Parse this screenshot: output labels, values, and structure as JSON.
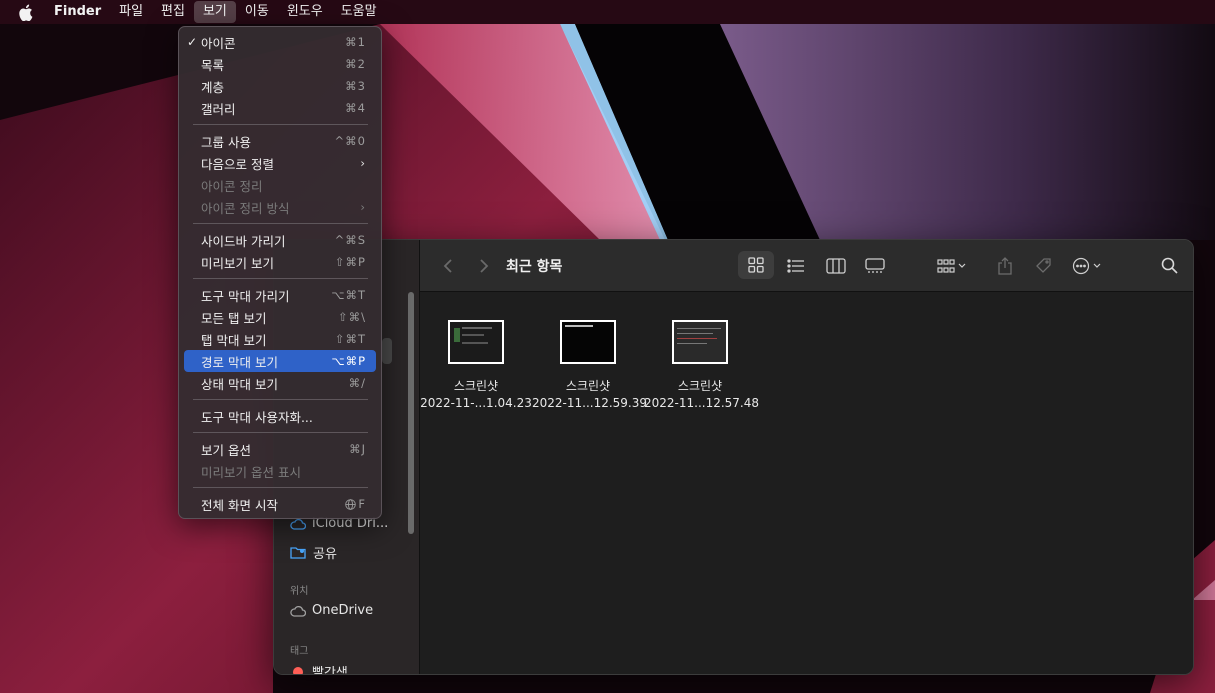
{
  "menubar": {
    "app": "Finder",
    "items": [
      "파일",
      "편집",
      "보기",
      "이동",
      "윈도우",
      "도움말"
    ],
    "active": "보기"
  },
  "view_menu": {
    "items": [
      {
        "label": "아이콘",
        "shortcut": "⌘1",
        "checked": true
      },
      {
        "label": "목록",
        "shortcut": "⌘2"
      },
      {
        "label": "계층",
        "shortcut": "⌘3"
      },
      {
        "label": "갤러리",
        "shortcut": "⌘4"
      },
      {
        "label": "그룹 사용",
        "shortcut": "^⌘0"
      },
      {
        "label": "다음으로 정렬",
        "shortcut": "",
        "submenu": true
      },
      {
        "label": "아이콘 정리",
        "shortcut": "",
        "disabled": true
      },
      {
        "label": "아이콘 정리 방식",
        "shortcut": "",
        "disabled": true,
        "submenu": true
      },
      {
        "label": "사이드바 가리기",
        "shortcut": "^⌘S"
      },
      {
        "label": "미리보기 보기",
        "shortcut": "⇧⌘P"
      },
      {
        "label": "도구 막대 가리기",
        "shortcut": "⌥⌘T"
      },
      {
        "label": "모든 탭 보기",
        "shortcut": "⇧⌘\\"
      },
      {
        "label": "탭 막대 보기",
        "shortcut": "⇧⌘T"
      },
      {
        "label": "경로 막대 보기",
        "shortcut": "⌥⌘P",
        "highlighted": true
      },
      {
        "label": "상태 막대 보기",
        "shortcut": "⌘/"
      },
      {
        "label": "도구 막대 사용자화...",
        "shortcut": ""
      },
      {
        "label": "보기 옵션",
        "shortcut": "⌘J"
      },
      {
        "label": "미리보기 옵션 표시",
        "shortcut": "",
        "disabled": true
      },
      {
        "label": "전체 화면 시작",
        "shortcut": "F"
      }
    ]
  },
  "finder": {
    "title": "최근 항목",
    "sidebar": {
      "icloud_drive": "iCloud Dri...",
      "shared": "공유",
      "locations_header": "위치",
      "onedrive": "OneDrive",
      "tags_header": "태그",
      "tag_red": "빨간색"
    },
    "files": [
      {
        "name": "스크린샷",
        "date": "2022-11-...1.04.23"
      },
      {
        "name": "스크린샷",
        "date": "2022-11...12.59.39"
      },
      {
        "name": "스크린샷",
        "date": "2022-11...12.57.48"
      }
    ]
  },
  "colors": {
    "menu_highlight": "#2f62c8",
    "tag_red": "#ff5f57",
    "folder_blue": "#4aa8ff"
  }
}
